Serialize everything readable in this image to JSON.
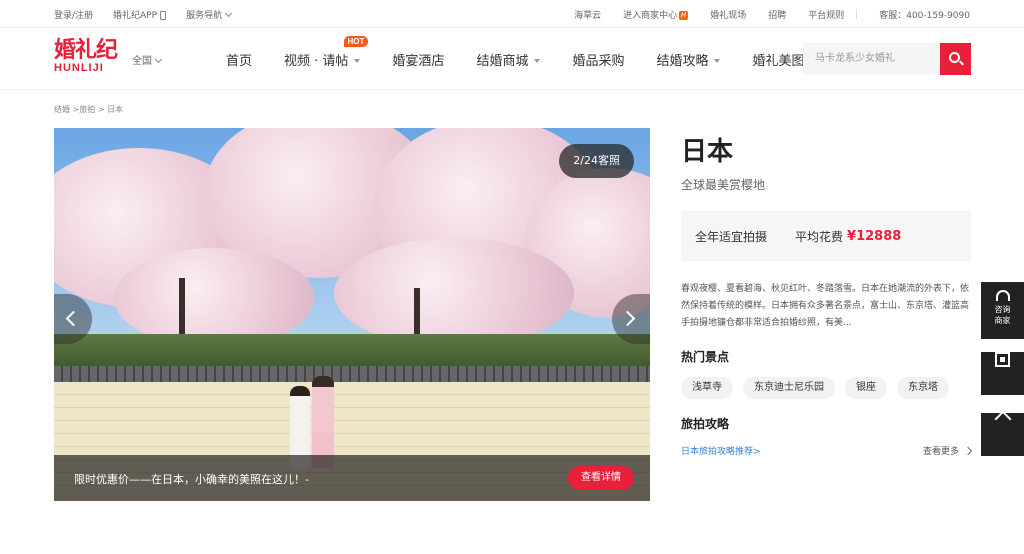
{
  "topbar": {
    "login": "登录/注册",
    "app": "婚礼纪APP",
    "service_nav": "服务导航",
    "haicaoyun": "海草云",
    "merchant_center": "进入商家中心",
    "merchant_badge": "H",
    "wedding_scene": "婚礼现场",
    "recruit": "招聘",
    "rules": "平台规则",
    "hotline": "客服：400-159-9090"
  },
  "header": {
    "logo_cn": "婚礼纪",
    "logo_en": "HUNLIJI",
    "city": "全国",
    "nav": [
      {
        "label": "首页",
        "dropdown": false
      },
      {
        "label": "视频 · 请帖",
        "dropdown": true,
        "badge": "HOT"
      },
      {
        "label": "婚宴酒店",
        "dropdown": false
      },
      {
        "label": "结婚商城",
        "dropdown": true
      },
      {
        "label": "婚品采购",
        "dropdown": false
      },
      {
        "label": "结婚攻略",
        "dropdown": true
      },
      {
        "label": "婚礼美图",
        "dropdown": true
      }
    ],
    "search_placeholder": "马卡龙系少女婚礼"
  },
  "breadcrumb": "结婚 >旅拍 > 日本",
  "hero": {
    "counter": "2/24客照",
    "promo_text": "限时优惠价——在日本，小确幸的美照在这儿！-",
    "detail_button": "查看详情"
  },
  "info": {
    "title": "日本",
    "subtitle": "全球最美赏樱地",
    "season": "全年适宜拍摄",
    "avg_cost_label": "平均花费",
    "avg_cost": "¥12888",
    "description": "春观夜樱、夏看碧海、秋见红叶、冬踏落雪。日本在她潮流的外表下，依然保持着传统的模样。日本拥有众多著名景点，富士山、东京塔、灌篮高手拍摄地镰仓都非常适合拍婚纱照，有美...",
    "spots_heading": "热门景点",
    "spots": [
      "浅草寺",
      "东京迪士尼乐园",
      "银座",
      "东京塔"
    ],
    "guide_heading": "旅拍攻略",
    "guide_link": "日本旅拍攻略推荐>",
    "see_more": "查看更多"
  },
  "float": {
    "consult": "咨询",
    "merchant": "商家"
  }
}
